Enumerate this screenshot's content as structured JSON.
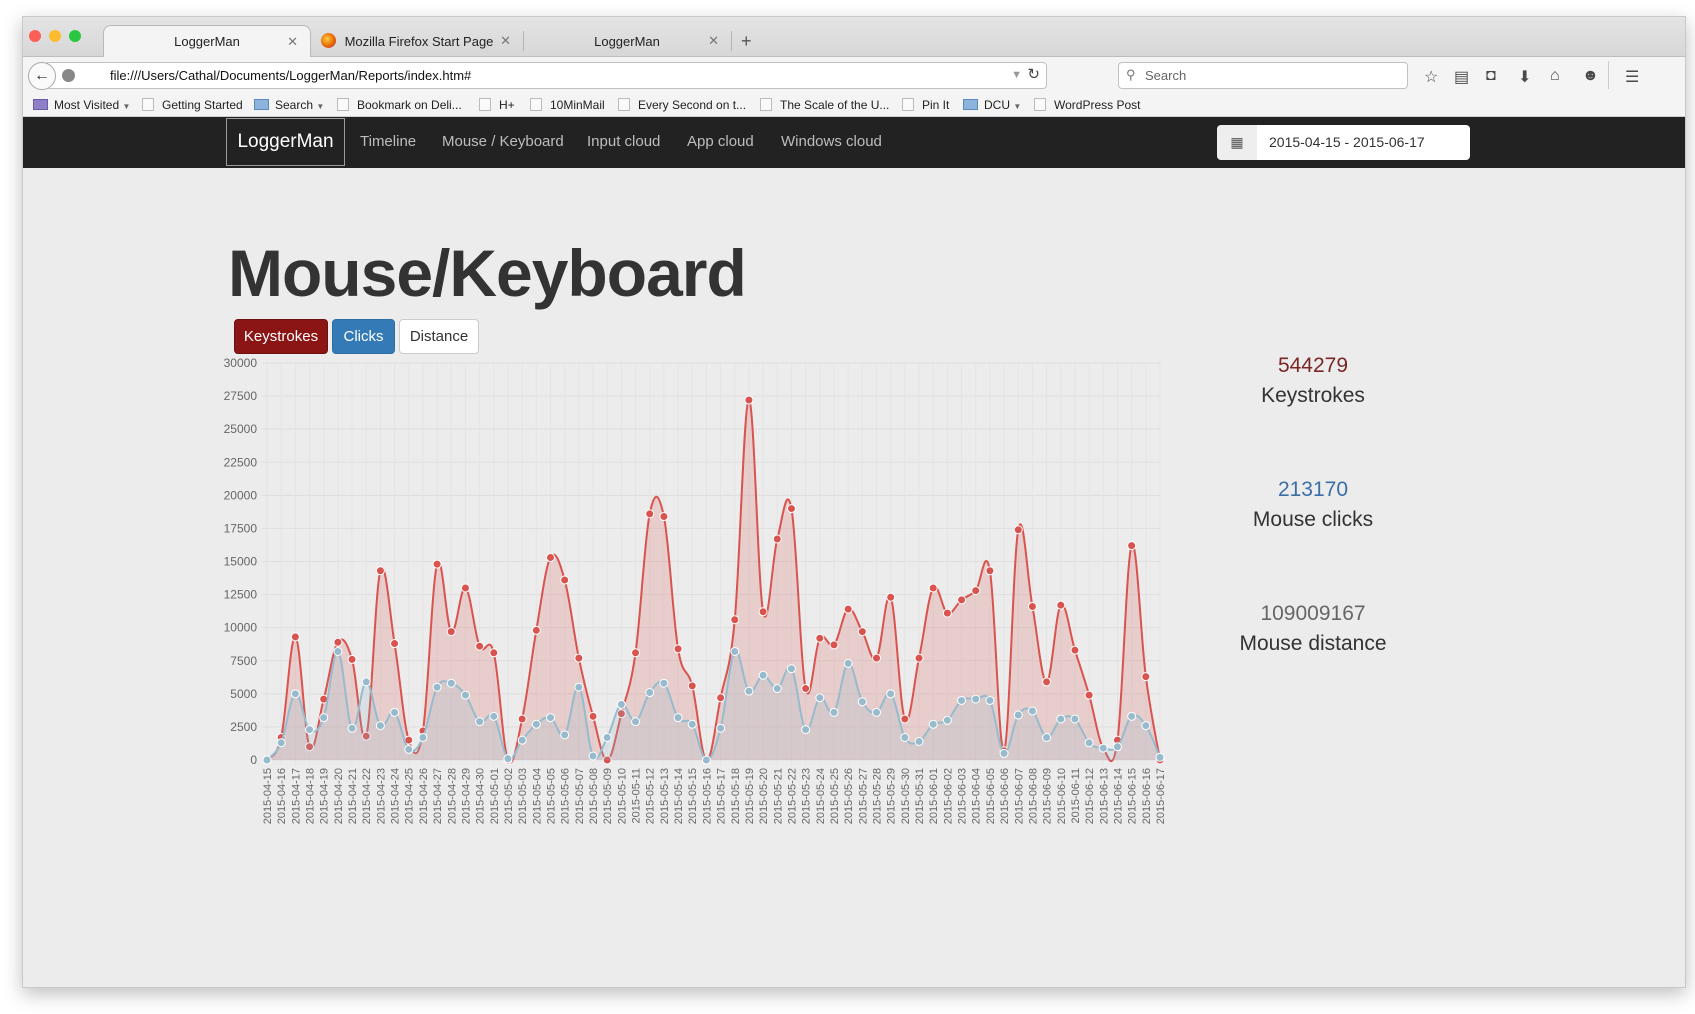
{
  "browser": {
    "tabs": [
      {
        "label": "LoggerMan",
        "active": true
      },
      {
        "label": "Mozilla Firefox Start Page",
        "active": false
      },
      {
        "label": "LoggerMan",
        "active": false
      }
    ],
    "url": "file:///Users/Cathal/Documents/LoggerMan/Reports/index.htm#",
    "search_placeholder": "Search",
    "bookmarks": [
      "Most Visited",
      "Getting Started",
      "Search",
      "Bookmark on Deli...",
      "H+",
      "10MinMail",
      "Every Second on t...",
      "The Scale of the U...",
      "Pin It",
      "DCU",
      "WordPress Post"
    ]
  },
  "app": {
    "brand": "LoggerMan",
    "nav": [
      "Timeline",
      "Mouse / Keyboard",
      "Input cloud",
      "App cloud",
      "Windows cloud"
    ],
    "date_range": "2015-04-15 - 2015-06-17"
  },
  "page": {
    "title": "Mouse/Keyboard",
    "buttons": {
      "keystrokes": "Keystrokes",
      "clicks": "Clicks",
      "distance": "Distance"
    }
  },
  "stats": {
    "keystrokes_value": "544279",
    "keystrokes_label": "Keystrokes",
    "clicks_value": "213170",
    "clicks_label": "Mouse clicks",
    "distance_value": "109009167",
    "distance_label": "Mouse distance"
  },
  "colors": {
    "keystrokes": "#d9534f",
    "clicks": "#97bbcd",
    "keystrokes_button": "#8b1414",
    "clicks_button": "#337ab7",
    "navbar": "#222222"
  },
  "chart_data": {
    "type": "line",
    "x": [
      "2015-04-15",
      "2015-04-16",
      "2015-04-17",
      "2015-04-18",
      "2015-04-19",
      "2015-04-20",
      "2015-04-21",
      "2015-04-22",
      "2015-04-23",
      "2015-04-24",
      "2015-04-25",
      "2015-04-26",
      "2015-04-27",
      "2015-04-28",
      "2015-04-29",
      "2015-04-30",
      "2015-05-01",
      "2015-05-02",
      "2015-05-03",
      "2015-05-04",
      "2015-05-05",
      "2015-05-06",
      "2015-05-07",
      "2015-05-08",
      "2015-05-09",
      "2015-05-10",
      "2015-05-11",
      "2015-05-12",
      "2015-05-13",
      "2015-05-14",
      "2015-05-15",
      "2015-05-16",
      "2015-05-17",
      "2015-05-18",
      "2015-05-19",
      "2015-05-20",
      "2015-05-21",
      "2015-05-22",
      "2015-05-23",
      "2015-05-24",
      "2015-05-25",
      "2015-05-26",
      "2015-05-27",
      "2015-05-28",
      "2015-05-29",
      "2015-05-30",
      "2015-05-31",
      "2015-06-01",
      "2015-06-02",
      "2015-06-03",
      "2015-06-04",
      "2015-06-05",
      "2015-06-06",
      "2015-06-07",
      "2015-06-08",
      "2015-06-09",
      "2015-06-10",
      "2015-06-11",
      "2015-06-12",
      "2015-06-13",
      "2015-06-14",
      "2015-06-15",
      "2015-06-16",
      "2015-06-17"
    ],
    "series": [
      {
        "key": "keystrokes",
        "values": [
          0,
          1700,
          9300,
          1000,
          4600,
          8900,
          7600,
          1800,
          14300,
          8800,
          1500,
          2200,
          14800,
          9700,
          13000,
          8600,
          8100,
          0,
          3100,
          9800,
          15300,
          13600,
          7700,
          3300,
          0,
          3500,
          8100,
          18600,
          18400,
          8400,
          5600,
          0,
          4700,
          10600,
          27200,
          11200,
          16700,
          19000,
          5400,
          9200,
          8700,
          11400,
          9700,
          7700,
          12300,
          3100,
          7700,
          13000,
          11100,
          12100,
          12800,
          14300,
          700,
          17400,
          11600,
          5900,
          11700,
          8300,
          4900,
          900,
          1500,
          16200,
          6300,
          0
        ]
      },
      {
        "key": "clicks",
        "values": [
          0,
          1300,
          5000,
          2300,
          3200,
          8200,
          2400,
          5900,
          2600,
          3600,
          800,
          1700,
          5500,
          5800,
          4900,
          2900,
          3300,
          100,
          1500,
          2700,
          3200,
          1900,
          5500,
          300,
          1700,
          4200,
          2900,
          5100,
          5800,
          3200,
          2700,
          0,
          2400,
          8200,
          5200,
          6400,
          5400,
          6900,
          2300,
          4700,
          3600,
          7300,
          4400,
          3600,
          5000,
          1700,
          1400,
          2700,
          3000,
          4500,
          4600,
          4500,
          500,
          3400,
          3700,
          1700,
          3100,
          3100,
          1300,
          900,
          1000,
          3300,
          2600,
          200
        ]
      }
    ],
    "ylim": [
      0,
      30000
    ],
    "yticks": [
      0,
      2500,
      5000,
      7500,
      10000,
      12500,
      15000,
      17500,
      20000,
      22500,
      25000,
      27500,
      30000
    ],
    "grid": true
  }
}
